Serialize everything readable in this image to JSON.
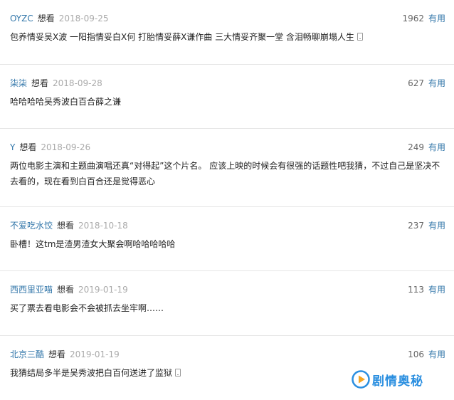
{
  "comments": [
    {
      "user": "OYZC",
      "status": "想看",
      "date": "2018-09-25",
      "votes": "1962",
      "useful_label": "有用",
      "text": "包养情妥吴X波 一阳指情妥白X何 打胎情妥薛X谦作曲 三大情妥齐聚一堂 含泪畅聊崩塌人生",
      "from_mobile": true
    },
    {
      "user": "柒柒",
      "status": "想看",
      "date": "2018-09-28",
      "votes": "627",
      "useful_label": "有用",
      "text": "哈哈哈哈吴秀波白百合薛之谦",
      "from_mobile": false
    },
    {
      "user": "Y",
      "status": "想看",
      "date": "2018-09-26",
      "votes": "249",
      "useful_label": "有用",
      "text": "两位电影主演和主题曲演唱还真“对得起”这个片名。 应该上映的时候会有很强的话题性吧我猜，不过自己是坚决不去看的，现在看到白百合还是觉得恶心",
      "from_mobile": false
    },
    {
      "user": "不爱吃水饺",
      "status": "想看",
      "date": "2018-10-18",
      "votes": "237",
      "useful_label": "有用",
      "text": "卧槽！这tm是渣男渣女大聚会啊哈哈哈哈哈",
      "from_mobile": false
    },
    {
      "user": "西西里亚喵",
      "status": "想看",
      "date": "2019-01-19",
      "votes": "113",
      "useful_label": "有用",
      "text": "买了票去看电影会不会被抓去坐牢啊……",
      "from_mobile": false
    },
    {
      "user": "北京三酷",
      "status": "想看",
      "date": "2019-01-19",
      "votes": "106",
      "useful_label": "有用",
      "text": "我猜结局多半是吴秀波把白百何送进了监狱",
      "from_mobile": true
    }
  ],
  "watermark": {
    "text": "剧情奥秘",
    "icon": "play-circle-icon",
    "color": "#2b8fe0"
  },
  "colors": {
    "link": "#3377aa",
    "date": "#aaaaaa",
    "divider": "#e6e6e6"
  }
}
